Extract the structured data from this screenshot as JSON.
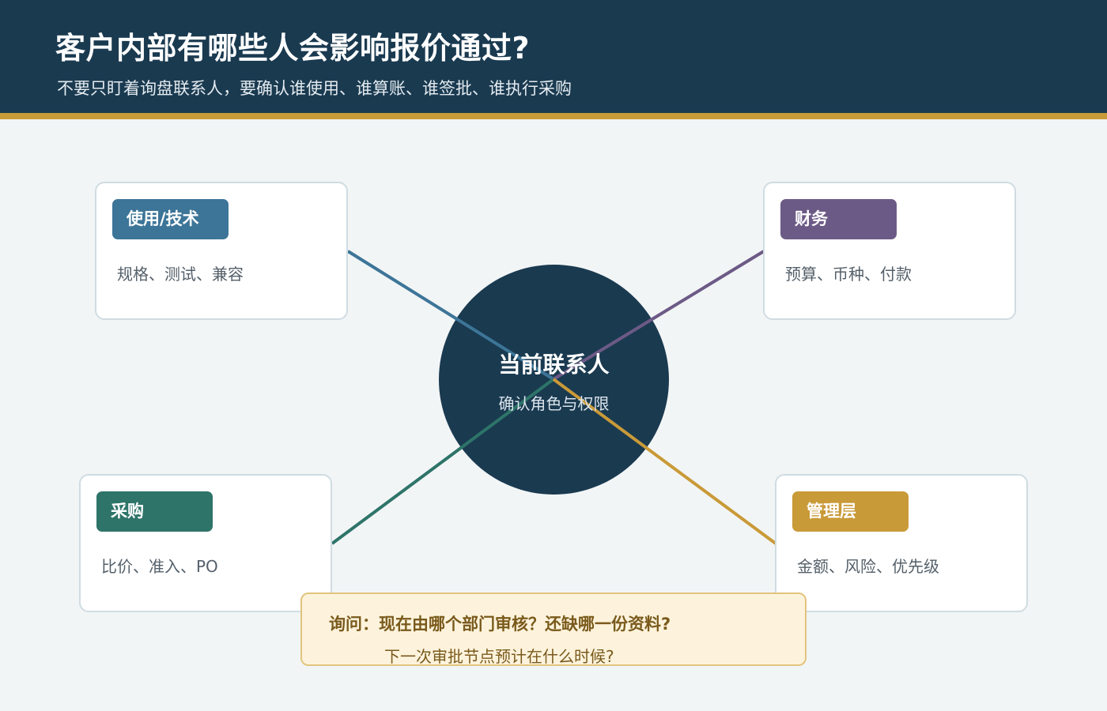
{
  "header": {
    "title": "客户内部有哪些人会影响报价通过?",
    "subtitle": "不要只盯着询盘联系人，要确认谁使用、谁算账、谁签批、谁执行采购"
  },
  "hub": {
    "title": "当前联系人",
    "subtitle": "确认角色与权限"
  },
  "roles": [
    {
      "id": "tech",
      "label": "使用/技术",
      "detail": "规格、测试、兼容",
      "color": "#3d7598"
    },
    {
      "id": "finance",
      "label": "财务",
      "detail": "预算、币种、付款",
      "color": "#6c5a86"
    },
    {
      "id": "purchasing",
      "label": "采购",
      "detail": "比价、准入、PO",
      "color": "#2e7469"
    },
    {
      "id": "management",
      "label": "管理层",
      "detail": "金额、风险、优先级",
      "color": "#c99a38"
    }
  ],
  "callout": {
    "question": "询问：现在由哪个部门审核？还缺哪一份资料?",
    "followup": "下一次审批节点预计在什么时候?"
  },
  "colors": {
    "header_bg": "#1a3a50",
    "accent": "#c99a38",
    "hub_bg": "#1a3a50"
  }
}
